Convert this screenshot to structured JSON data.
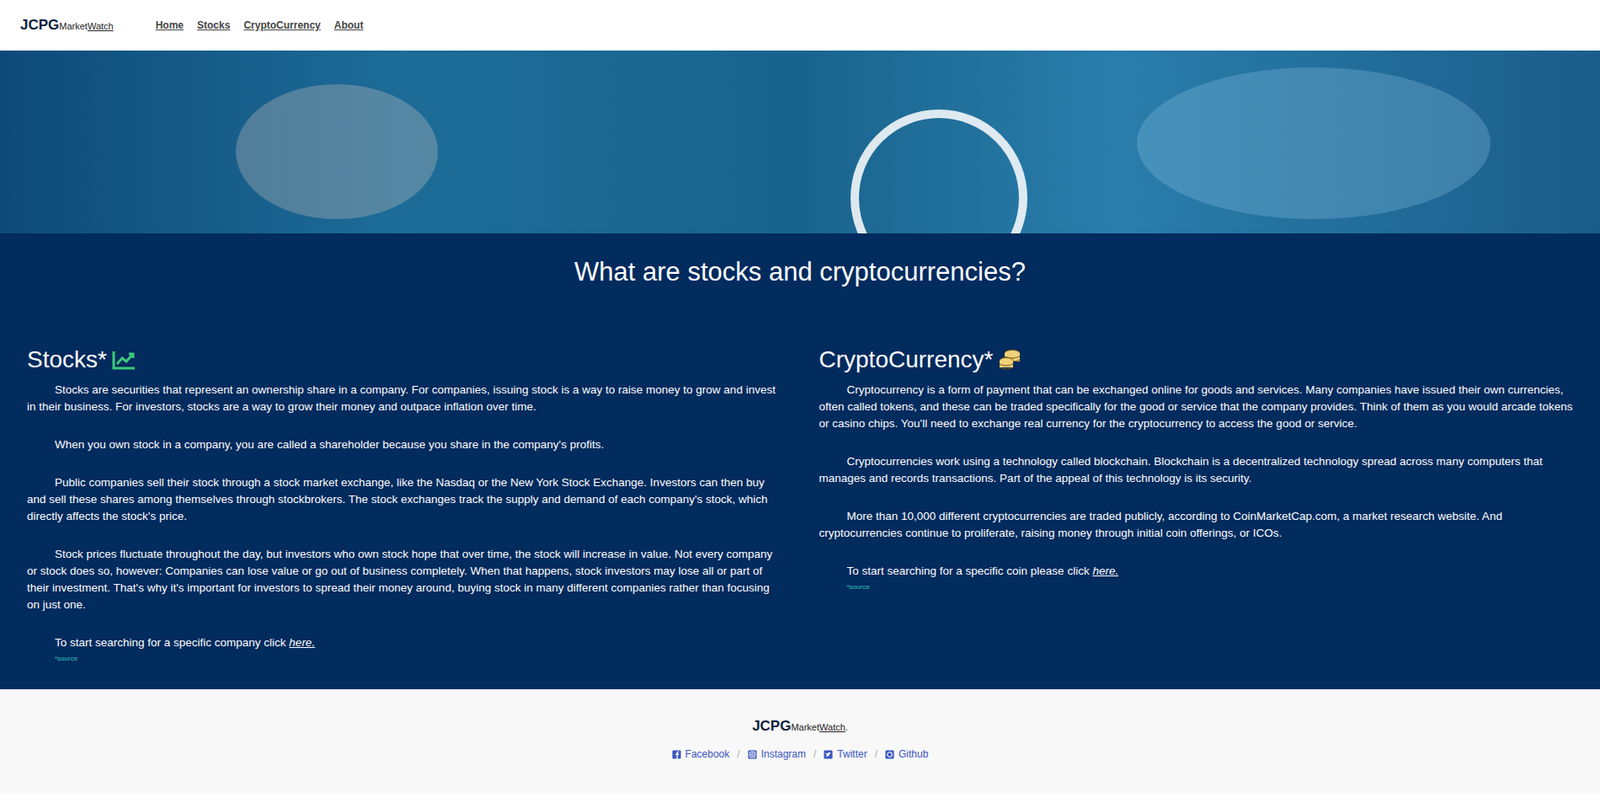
{
  "header": {
    "logo": {
      "brand": "JCPG",
      "market": "Market",
      "watch": "Watch"
    },
    "nav": [
      {
        "label": "Home"
      },
      {
        "label": "Stocks"
      },
      {
        "label": "CryptoCurrency"
      },
      {
        "label": "About"
      }
    ]
  },
  "intro": {
    "title": "What are stocks and cryptocurrencies?"
  },
  "sections": [
    {
      "title": "Stocks*",
      "kind": "chart",
      "color": "#3ec97a",
      "paragraphs": [
        "Stocks are securities that represent an ownership share in a company. For companies, issuing stock is a way to raise money to grow and invest in their business. For investors, stocks are a way to grow their money and outpace inflation over time.",
        "When you own stock in a company, you are called a shareholder because you share in the company's profits.",
        "Public companies sell their stock through a stock market exchange, like the Nasdaq or the New York Stock Exchange. Investors can then buy and sell these shares among themselves through stockbrokers. The stock exchanges track the supply and demand of each company's stock, which directly affects the stock's price.",
        "Stock prices fluctuate throughout the day, but investors who own stock hope that over time, the stock will increase in value. Not every company or stock does so, however: Companies can lose value or go out of business completely. When that happens, stock investors may lose all or part of their investment. That's why it's important for investors to spread their money around, buying stock in many different companies rather than focusing on just one."
      ],
      "cta": {
        "text": "To start searching for a specific company click ",
        "link": "here."
      },
      "source": "*source"
    },
    {
      "title": "CryptoCurrency*",
      "kind": "coins",
      "color": "#f1d27a",
      "paragraphs": [
        "Cryptocurrency is a form of payment that can be exchanged online for goods and services. Many companies have issued their own currencies, often called tokens, and these can be traded specifically for the good or service that the company provides. Think of them as you would arcade tokens or casino chips. You'll need to exchange real currency for the cryptocurrency to access the good or service.",
        "Cryptocurrencies work using a technology called blockchain. Blockchain is a decentralized technology spread across many computers that manages and records transactions. Part of the appeal of this technology is its security.",
        "More than 10,000 different cryptocurrencies are traded publicly, according to CoinMarketCap.com, a market research website. And cryptocurrencies continue to proliferate, raising money through initial coin offerings, or ICOs."
      ],
      "cta": {
        "text": "To start searching for a specific coin please click ",
        "link": "here."
      },
      "source": "*source"
    }
  ],
  "footer": {
    "logo": {
      "brand": "JCPG",
      "market": "Market",
      "watch": "Watch",
      "dot": "."
    },
    "separator": "/",
    "links": [
      {
        "label": "Facebook",
        "kind": "facebook"
      },
      {
        "label": "Instagram",
        "kind": "instagram"
      },
      {
        "label": "Twitter",
        "kind": "twitter"
      },
      {
        "label": "Github",
        "kind": "github"
      }
    ]
  }
}
